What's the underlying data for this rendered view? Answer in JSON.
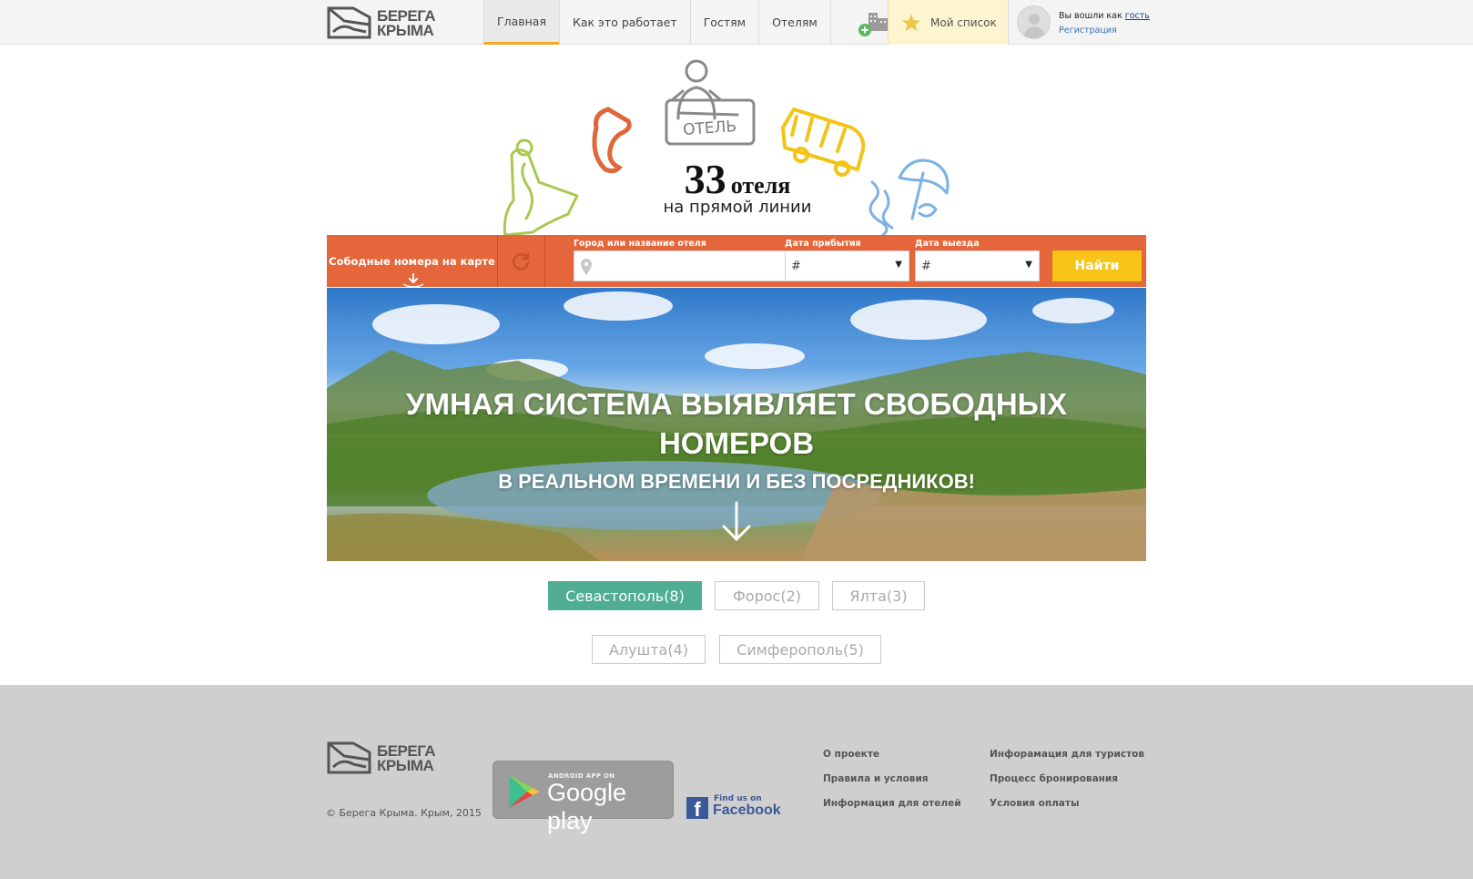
{
  "header": {
    "logo_line1": "БЕРЕГА",
    "logo_line2": "КРЫМА",
    "nav": [
      "Главная",
      "Как это работает",
      "Гостям",
      "Отелям"
    ],
    "mylist": "Мой список",
    "user_prefix": "Вы вошли как",
    "user_name": "гость",
    "register": "Регистрация"
  },
  "hero": {
    "count": "33",
    "count_unit": "отеля",
    "subtitle": "на прямой линии",
    "hotel_sign": "ОТЕЛЬ"
  },
  "search": {
    "map_button": "Сободные номера на карте",
    "city_label": "Город или название отеля",
    "city_value": "",
    "arrival_label": "Дата прибытия",
    "arrival_value": "#",
    "departure_label": "Дата выезда",
    "departure_value": "#",
    "find_button": "Найти"
  },
  "banner": {
    "headline": "УМНАЯ СИСТЕМА ВЫЯВЛЯЕТ СВОБОДНЫХ НОМЕРОВ",
    "subline": "В РЕАЛЬНОМ ВРЕМЕНИ И БЕЗ ПОСРЕДНИКОВ!"
  },
  "cities": [
    {
      "label": "Севастополь(8)",
      "active": true
    },
    {
      "label": "Форос(2)",
      "active": false
    },
    {
      "label": "Ялта(3)",
      "active": false
    },
    {
      "label": "Алушта(4)",
      "active": false
    },
    {
      "label": "Симферополь(5)",
      "active": false
    }
  ],
  "footer": {
    "copyright": "© Берега Крыма. Крым, 2015",
    "gplay_small": "ANDROID APP ON",
    "gplay_big": "Google play",
    "fb_small": "Find us on",
    "fb_big": "Facebook",
    "links_col1": [
      "О проекте",
      "Правила и условия",
      "Информация для отелей"
    ],
    "links_col2": [
      "Инфорамация для туристов",
      "Процесс бронирования",
      "Условия оплаты"
    ]
  },
  "colors": {
    "accent_orange": "#e4663a",
    "find_yellow": "#f7c417",
    "city_active": "#4fae93",
    "nav_active_underline": "#f5a623"
  },
  "icons": [
    "logo-icon",
    "add-hotel-icon",
    "star-icon",
    "avatar-icon",
    "refresh-icon",
    "location-pin-icon",
    "chevron-down-icon",
    "arrow-down-icon",
    "google-play-icon",
    "facebook-icon"
  ]
}
